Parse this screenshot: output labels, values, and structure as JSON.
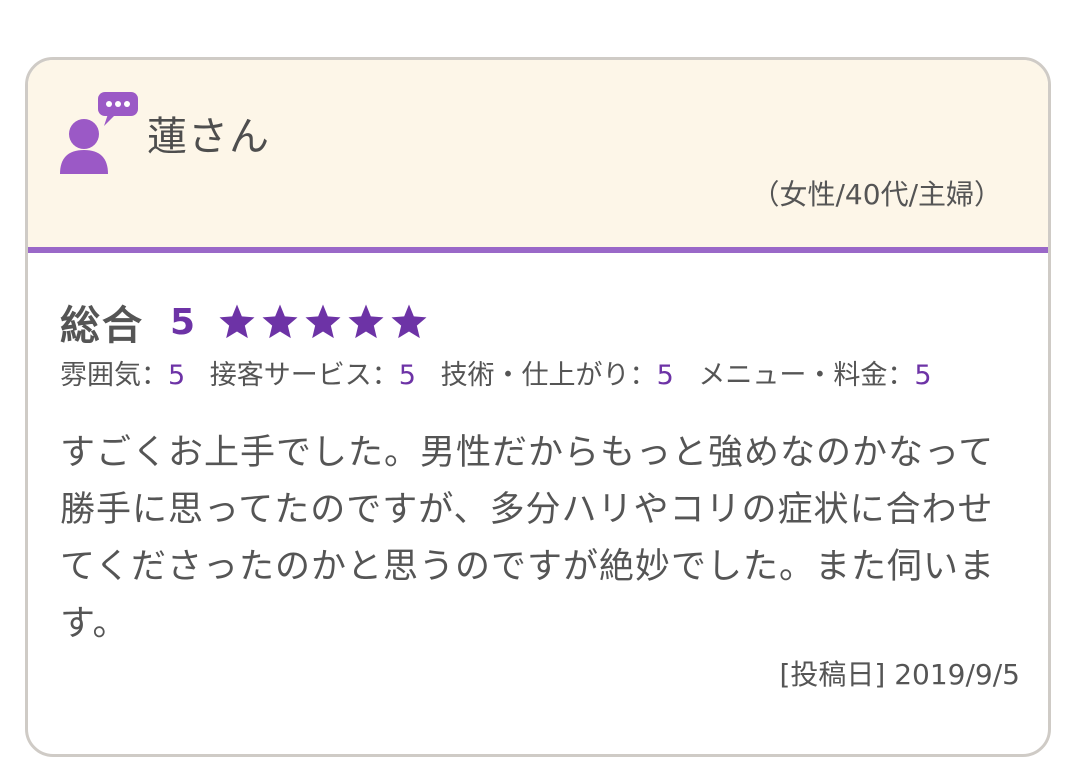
{
  "reviewer": {
    "name": "蓮さん",
    "meta": "（女性/40代/主婦）",
    "avatar_icon": "user-chat-icon"
  },
  "rating": {
    "overall_label": "総合",
    "overall_score": "5",
    "stars_filled": 5,
    "stars_total": 5,
    "items": [
      {
        "label": "雰囲気：",
        "value": "5"
      },
      {
        "label": "接客サービス：",
        "value": "5"
      },
      {
        "label": "技術・仕上がり：",
        "value": "5"
      },
      {
        "label": "メニュー・料金：",
        "value": "5"
      }
    ]
  },
  "comment": "すごくお上手でした。男性だからもっと強めなのかなって勝手に思ってたのですが、多分ハリやコリの症状に合わせてくださったのかと思うのですが絶妙でした。また伺います。",
  "posted": "[投稿日] 2019/9/5",
  "colors": {
    "accent": "#6d33a6",
    "header_bg": "#fdf6e8",
    "divider": "#9a68c8",
    "icon": "#9b59c6"
  }
}
